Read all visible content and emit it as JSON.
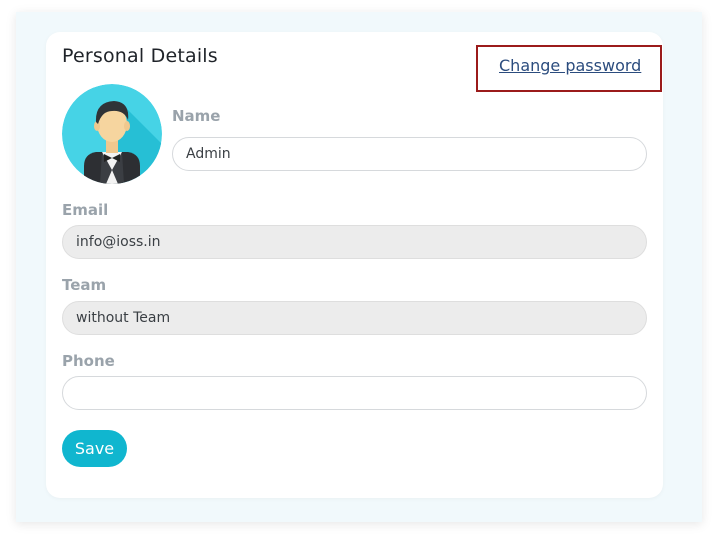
{
  "profile": {
    "title": "Personal Details",
    "change_password_link": "Change password",
    "avatar": {
      "icon": "user-avatar-icon",
      "background": "#46d3e6"
    },
    "name": {
      "label": "Name",
      "value": "Admin"
    },
    "email": {
      "label": "Email",
      "value": "info@ioss.in"
    },
    "team": {
      "label": "Team",
      "value": "without Team"
    },
    "phone": {
      "label": "Phone",
      "value": ""
    },
    "save_label": "Save"
  },
  "colors": {
    "accent": "#10b6cf",
    "highlight_border": "#9b1b1b",
    "link": "#2b4c7e"
  }
}
